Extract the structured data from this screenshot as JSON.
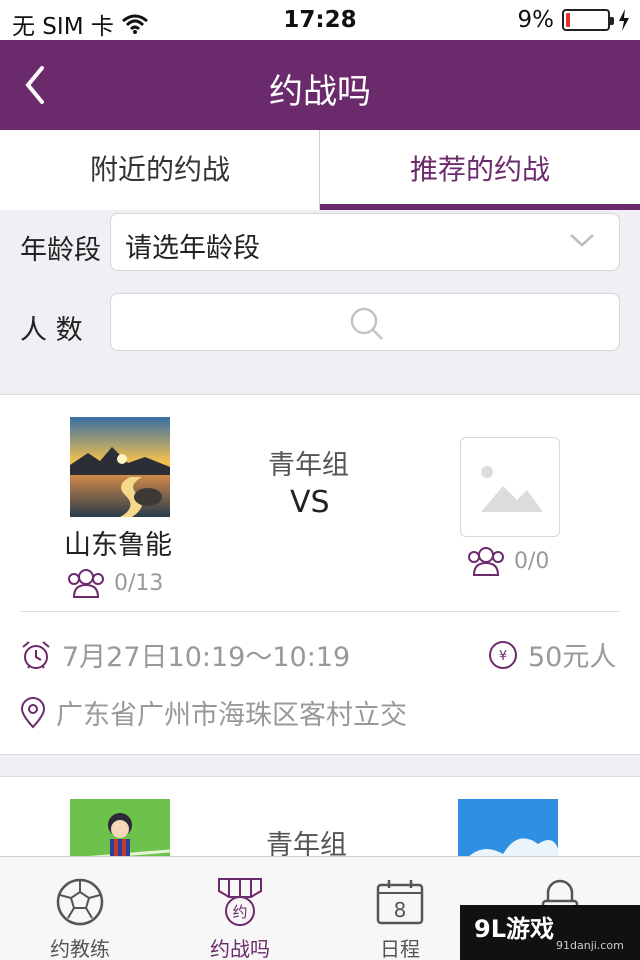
{
  "status_bar": {
    "carrier": "无 SIM 卡",
    "time": "17:28",
    "battery_percent": "9%",
    "battery_level": 0.09
  },
  "nav": {
    "title": "约战吗"
  },
  "tabs": [
    {
      "label": "附近的约战",
      "active": false
    },
    {
      "label": "推荐的约战",
      "active": true
    }
  ],
  "filter": {
    "age_label": "年龄段",
    "age_value": "请选年龄段",
    "count_label": "人 数",
    "count_placeholder": ""
  },
  "matches": [
    {
      "home_name": "山东鲁能",
      "home_members": "0/13",
      "group": "青年组",
      "vs": "VS",
      "away_members": "0/0",
      "time": "7月27日10:19～10:19",
      "price": "50元人",
      "location": "广东省广州市海珠区客村立交"
    },
    {
      "group": "青年组"
    }
  ],
  "tabbar": [
    {
      "label": "约教练",
      "icon": "soccer-ball-icon"
    },
    {
      "label": "约战吗",
      "icon": "medal-icon",
      "badge": "约",
      "active": true
    },
    {
      "label": "日程",
      "icon": "calendar-icon",
      "badge": "8"
    },
    {
      "label": "",
      "icon": "lock-icon"
    }
  ],
  "watermark": {
    "brand": "9L游戏",
    "site": "91danji.com"
  },
  "colors": {
    "brand": "#6b2a6c",
    "battery_low": "#e0312f"
  }
}
